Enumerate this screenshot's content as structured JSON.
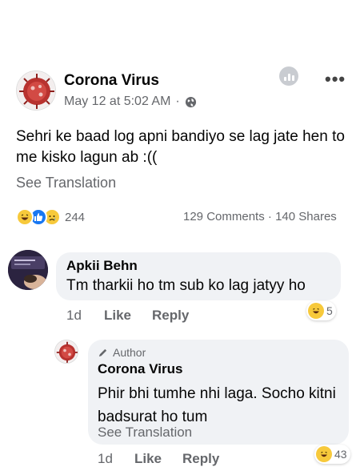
{
  "post": {
    "author": "Corona Virus",
    "date": "May 12 at 5:02 AM",
    "meta_separator": "·",
    "text": "Sehri ke baad log apni bandiyo se lag jate hen to me kisko lagun ab :((",
    "see_translation": "See Translation",
    "more_icon": "more-horizontal-icon",
    "insights_icon": "insights-icon",
    "privacy_icon": "globe-icon"
  },
  "reactions": {
    "types": [
      "haha",
      "like",
      "sad"
    ],
    "count": "244",
    "comments": "129 Comments",
    "separator": "·",
    "shares": "140 Shares"
  },
  "comments": [
    {
      "author": "Apkii Behn",
      "text": "Tm tharkii ho tm sub ko lag jatyy ho",
      "time": "1d",
      "like_label": "Like",
      "reply_label": "Reply",
      "reaction": "haha",
      "reaction_count": "5"
    }
  ],
  "reply": {
    "badge": "Author",
    "author": "Corona Virus",
    "text": "Phir bhi tumhe nhi laga. Socho kitni badsurat ho tum",
    "see_translation": "See Translation",
    "time": "1d",
    "like_label": "Like",
    "reply_label": "Reply",
    "reaction": "haha",
    "reaction_count": "43"
  },
  "colors": {
    "accent": "#1877f2",
    "muted": "#65676b",
    "bubble": "#f0f2f5",
    "haha": "#f7c93b"
  }
}
